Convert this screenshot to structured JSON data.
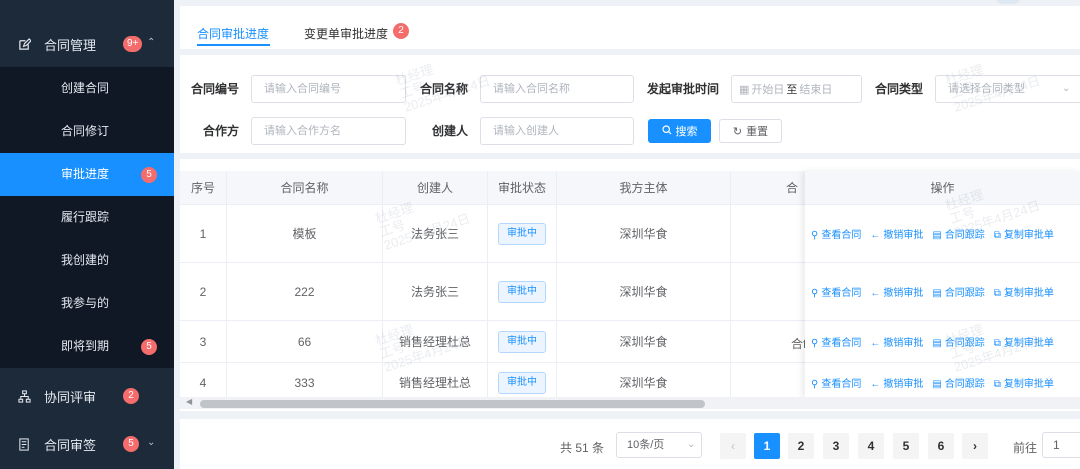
{
  "sidebar": {
    "contract_mgmt": {
      "label": "合同管理",
      "badge": "9+"
    },
    "sub_items": [
      {
        "label": "创建合同"
      },
      {
        "label": "合同修订"
      },
      {
        "label": "审批进度",
        "badge": "5"
      },
      {
        "label": "履行跟踪"
      },
      {
        "label": "我创建的"
      },
      {
        "label": "我参与的"
      },
      {
        "label": "即将到期",
        "badge": "5"
      }
    ],
    "collab_review": {
      "label": "协同评审",
      "badge": "2"
    },
    "contract_sign": {
      "label": "合同审签",
      "badge": "5"
    }
  },
  "tabs": {
    "items": [
      {
        "label": "合同审批进度",
        "active": true
      },
      {
        "label": "变更单审批进度",
        "badge": "2"
      }
    ]
  },
  "filters": {
    "contract_no": {
      "label": "合同编号",
      "placeholder": "请输入合同编号"
    },
    "contract_name": {
      "label": "合同名称",
      "placeholder": "请输入合同名称"
    },
    "approval_time": {
      "label": "发起审批时间",
      "start_placeholder": "开始日",
      "separator": "至",
      "end_placeholder": "结束日"
    },
    "contract_type": {
      "label": "合同类型",
      "placeholder": "请选择合同类型"
    },
    "partner": {
      "label": "合作方",
      "placeholder": "请输入合作方名"
    },
    "creator": {
      "label": "创建人",
      "placeholder": "请输入创建人"
    },
    "search_label": "搜索",
    "reset_label": "重置"
  },
  "table": {
    "columns": [
      "序号",
      "合同名称",
      "创建人",
      "审批状态",
      "我方主体",
      "合",
      "操作"
    ],
    "rows": [
      {
        "index": "1",
        "name": "模板",
        "creator": "法务张三",
        "status": "审批中",
        "entity": "深圳华食",
        "cut": ""
      },
      {
        "index": "2",
        "name": "222",
        "creator": "法务张三",
        "status": "审批中",
        "entity": "深圳华食",
        "cut": ""
      },
      {
        "index": "3",
        "name": "66",
        "creator": "销售经理杜总",
        "status": "审批中",
        "entity": "深圳华食",
        "cut": "合fi"
      },
      {
        "index": "4",
        "name": "333",
        "creator": "销售经理杜总",
        "status": "审批中",
        "entity": "深圳华食",
        "cut": ""
      }
    ],
    "operations": [
      "查看合同",
      "撤销审批",
      "合同跟踪",
      "复制审批单"
    ]
  },
  "pagination": {
    "total": "共 51 条",
    "page_size": "10条/页",
    "pages": [
      "1",
      "2",
      "3",
      "4",
      "5",
      "6"
    ],
    "current": "1",
    "goto_label": "前往",
    "goto_value": "1"
  },
  "watermark": {
    "line1": "杜经理",
    "line2": "工号",
    "line3": "2025年4月24日"
  }
}
